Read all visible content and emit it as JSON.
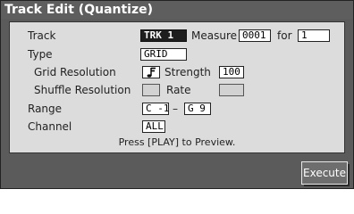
{
  "window": {
    "title": "Track Edit (Quantize)"
  },
  "fields": {
    "track": {
      "label": "Track",
      "value": "TRK 1"
    },
    "measure": {
      "label": "Measure",
      "value": "0001"
    },
    "for": {
      "label": "for",
      "value": "1"
    },
    "type": {
      "label": "Type",
      "value": "GRID"
    },
    "grid_resolution": {
      "label": "Grid Resolution",
      "icon": "sixteenth-note-icon"
    },
    "strength": {
      "label": "Strength",
      "value": "100"
    },
    "shuffle_resolution": {
      "label": "Shuffle Resolution",
      "value": ""
    },
    "rate": {
      "label": "Rate",
      "value": ""
    },
    "range": {
      "label": "Range",
      "from": "C -1",
      "dash": "–",
      "to": "G 9"
    },
    "channel": {
      "label": "Channel",
      "value": "ALL"
    }
  },
  "hint": "Press [PLAY] to Preview.",
  "footer": {
    "execute_label": "Execute"
  }
}
